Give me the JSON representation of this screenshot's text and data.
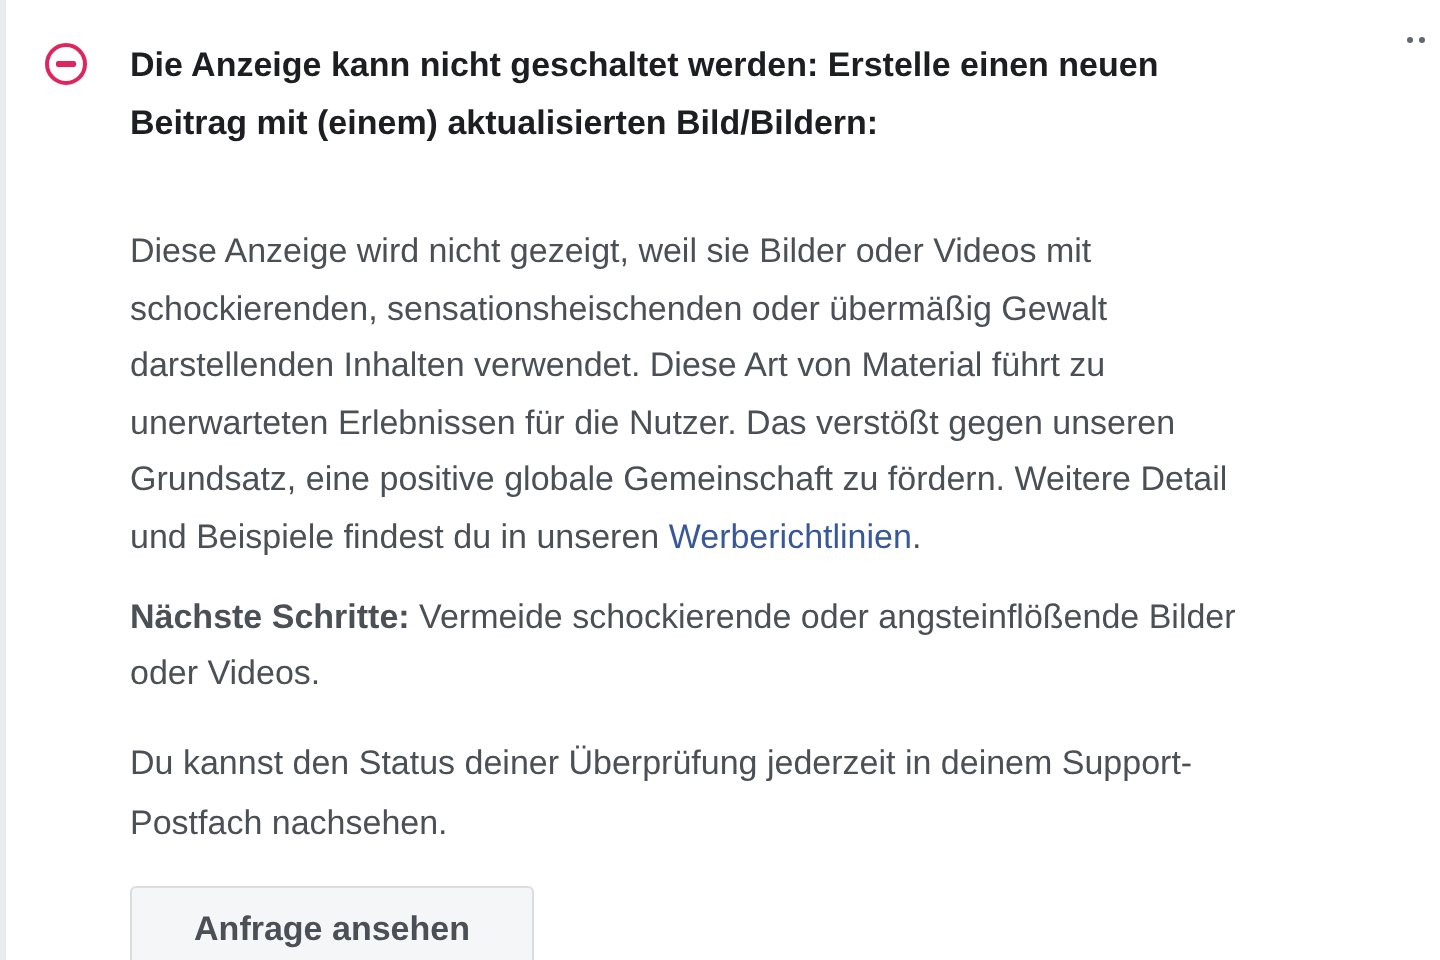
{
  "notice": {
    "title_lines": [
      "Die Anzeige kann nicht geschaltet werden: Erstelle einen neuen",
      "Beitrag mit (einem) aktualisierten Bild/Bildern:"
    ],
    "description": {
      "lines": [
        "Diese Anzeige wird nicht gezeigt, weil sie Bilder oder Videos mit",
        "schockierenden, sensationsheischenden oder übermäßig Gewalt",
        "darstellenden Inhalten verwendet. Diese Art von Material führt zu",
        "unerwarteten Erlebnissen für die Nutzer. Das verstößt gegen unseren",
        "Grundsatz, eine positive globale Gemeinschaft zu fördern. Weitere Detail",
        "und Beispiele findest du in unseren"
      ],
      "link": "Werberichtlinien",
      "link_tail": "."
    },
    "next_steps_lines": [
      "**Nächste Schritte:** Vermeide schockierende oder angsteinflößende Bilder",
      "oder Videos."
    ],
    "status_lines": [
      "Du kannst den Status deiner Überprüfung jederzeit in deinem Support-",
      "Postfach nachsehen."
    ],
    "button": "Anfrage ansehen"
  }
}
